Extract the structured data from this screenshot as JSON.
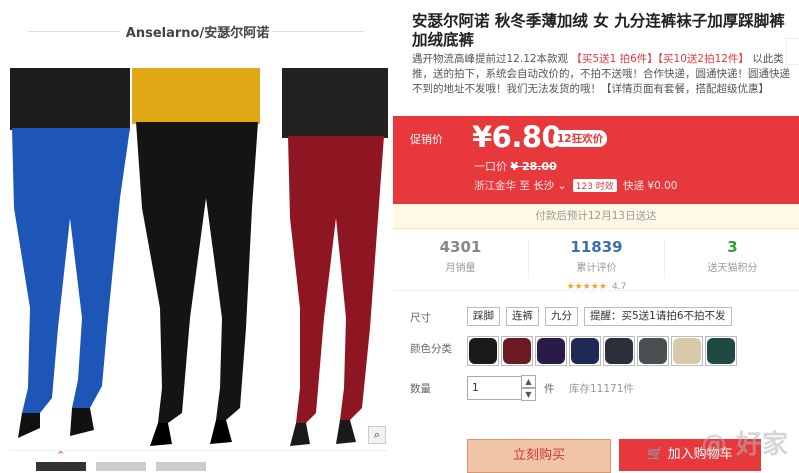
{
  "brand": {
    "title": "Anselarno/安瑟尔阿诺"
  },
  "product": {
    "title": "安瑟尔阿诺 秋冬季薄加绒 女 九分连裤袜子加厚踩脚裤 加绒底裤",
    "subtitle_a": "遇开物流高峰提前过12.12本款观",
    "subtitle_b": "【买5送1 拍6件】【买10送2拍12件】",
    "subtitle_c": "以此类推，送的拍下，系统会自动改价的，不拍不送哦！合作快递，圆通快递！圆通快递不到的地址不发哦！我们无法发货的哦！【详情页面有套餐，搭配超级优惠】"
  },
  "price": {
    "label": "促销价",
    "current": "¥6.80",
    "promo": "12狂欢价",
    "original_label": "一口价",
    "original": "¥ 28.00",
    "ship_from": "浙江金华",
    "ship_to_label": "至",
    "ship_city": "长沙",
    "ship_badge": "123 时效",
    "ship_fee": "快递 ¥0.00"
  },
  "delivery_note": "付款后预计12月13日送达",
  "stats": {
    "sales": {
      "value": "4301",
      "label": "月销量"
    },
    "reviews": {
      "value": "11839",
      "label": "累计评价",
      "rating": "4.7",
      "stars": "★★★★★"
    },
    "points": {
      "value": "3",
      "label": "送天猫积分"
    }
  },
  "options": {
    "size_label": "尺寸",
    "sizes": [
      "踩脚",
      "连裤",
      "九分",
      "提醒：买5送1请拍6不拍不发"
    ],
    "color_label": "颜色分类",
    "swatch_colors": [
      "#1a1a1a",
      "#6b1a22",
      "#2a1a4a",
      "#1e2a55",
      "#2b2f3a",
      "#4a4f52",
      "#d8c9a8",
      "#1e4a43"
    ],
    "qty_label": "数量",
    "qty_value": "1",
    "qty_unit": "件",
    "stock": "库存11171件"
  },
  "actions": {
    "buy": "立刻购买",
    "cart": "加入购物车"
  },
  "watermark": "@ 好家",
  "zoom_icon": "magnifier-icon"
}
